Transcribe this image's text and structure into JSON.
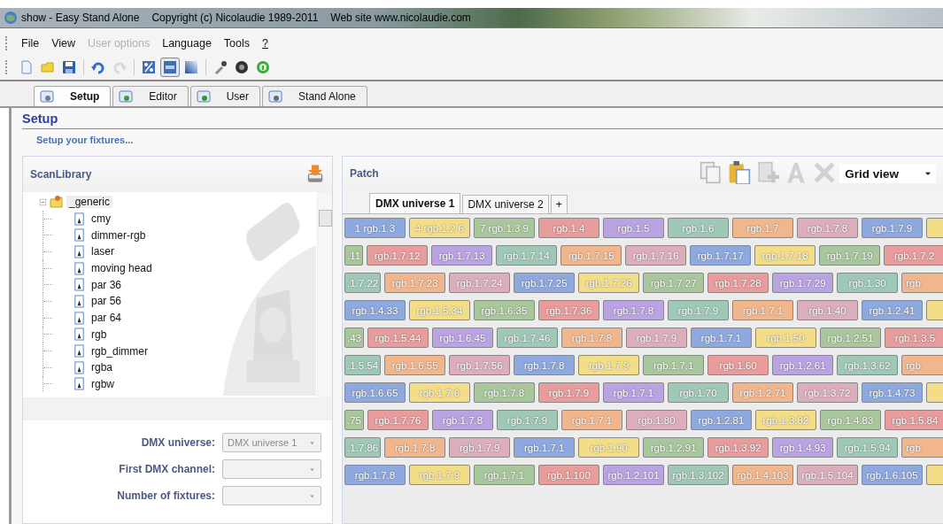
{
  "window": {
    "title": "show - Easy Stand Alone",
    "copyright": "Copyright (c) Nicolaudie 1989-2011",
    "website": "Web site www.nicolaudie.com"
  },
  "menu": [
    {
      "label": "File",
      "disabled": false,
      "underlined": false
    },
    {
      "label": "View",
      "disabled": false,
      "underlined": false
    },
    {
      "label": "User options",
      "disabled": true,
      "underlined": false
    },
    {
      "label": "Language",
      "disabled": false,
      "underlined": false
    },
    {
      "label": "Tools",
      "disabled": false,
      "underlined": false
    },
    {
      "label": "?",
      "disabled": false,
      "underlined": true
    }
  ],
  "toolbar": [
    {
      "kind": "new",
      "disabled": false,
      "pressed": false
    },
    {
      "kind": "open",
      "disabled": false,
      "pressed": false
    },
    {
      "kind": "save",
      "disabled": false,
      "pressed": false
    },
    {
      "kind": "sep"
    },
    {
      "kind": "undo",
      "disabled": false,
      "pressed": false
    },
    {
      "kind": "redo",
      "disabled": true,
      "pressed": false
    },
    {
      "kind": "sep"
    },
    {
      "kind": "percent",
      "disabled": false,
      "pressed": false
    },
    {
      "kind": "byte",
      "disabled": false,
      "pressed": true
    },
    {
      "kind": "gradient",
      "disabled": false,
      "pressed": false
    },
    {
      "kind": "sep"
    },
    {
      "kind": "picker",
      "disabled": false,
      "pressed": false
    },
    {
      "kind": "ball",
      "disabled": false,
      "pressed": false
    },
    {
      "kind": "help",
      "disabled": false,
      "pressed": false
    }
  ],
  "tabs": [
    {
      "label": "Setup",
      "kind": "setup",
      "selected": true
    },
    {
      "label": "Editor",
      "kind": "editor",
      "selected": false
    },
    {
      "label": "User",
      "kind": "user",
      "selected": false
    },
    {
      "label": "Stand Alone",
      "kind": "standalone",
      "selected": false
    }
  ],
  "page": {
    "title": "Setup",
    "subtitle": "Setup your fixtures..."
  },
  "library": {
    "title": "ScanLibrary",
    "tree": [
      {
        "label": "_generic",
        "expanded": true,
        "selected": true,
        "children": [
          {
            "label": "cmy"
          },
          {
            "label": "dimmer-rgb"
          },
          {
            "label": "laser"
          },
          {
            "label": "moving head"
          },
          {
            "label": "par 36"
          },
          {
            "label": "par 56"
          },
          {
            "label": "par 64"
          },
          {
            "label": "rgb"
          },
          {
            "label": "rgb_dimmer"
          },
          {
            "label": "rgba"
          },
          {
            "label": "rgbw"
          }
        ]
      }
    ]
  },
  "form": [
    {
      "label": "DMX universe:",
      "value": "DMX universe 1",
      "disabled": true
    },
    {
      "label": "First DMX channel:",
      "disabled": true
    },
    {
      "label": "Number of fixtures:",
      "disabled": true
    }
  ],
  "patch": {
    "title": "Patch",
    "tools": [
      {
        "kind": "copy",
        "disabled": true
      },
      {
        "kind": "paste",
        "disabled": false
      },
      {
        "kind": "add",
        "disabled": true
      },
      {
        "kind": "letter",
        "disabled": true
      },
      {
        "kind": "delete",
        "disabled": true
      }
    ],
    "view": "Grid view",
    "tabs": [
      {
        "label": "DMX universe 1",
        "selected": true
      },
      {
        "label": "DMX universe 2",
        "selected": false
      },
      {
        "label": "+",
        "selected": false
      }
    ],
    "grid": [
      [
        {
          "label": "1 rgb.1 3",
          "color": "#8ea9df",
          "kind": "full"
        },
        {
          "label": "4 rgb.1.2 6",
          "color": "#f3dd86",
          "kind": "full"
        },
        {
          "label": "7 rgb.1.3 9",
          "color": "#a9c79c",
          "kind": "full"
        },
        {
          "label": "rgb.1.4",
          "color": "#e89c9c",
          "kind": "full"
        },
        {
          "label": "rgb.1.5",
          "color": "#b9a3e3",
          "kind": "full"
        },
        {
          "label": "rgb.1.6",
          "color": "#9fc8b7",
          "kind": "full"
        },
        {
          "label": "rgb.1.7",
          "color": "#f2b68c",
          "kind": "full"
        },
        {
          "label": "rgb.1.7.8",
          "color": "#dcaebb",
          "kind": "full"
        },
        {
          "label": "rgb.1.7.9",
          "color": "#8ea9df",
          "kind": "full"
        },
        {
          "color": "#f3dd86",
          "kind": "full"
        }
      ],
      [
        {
          "label": ".11",
          "color": "#a9c79c",
          "kind": "partial"
        },
        {
          "label": "rgb.1.7.12",
          "color": "#e89c9c",
          "kind": "full"
        },
        {
          "label": "rgb.1.7.13",
          "color": "#b9a3e3",
          "kind": "full"
        },
        {
          "label": "rgb.1.7.14",
          "color": "#9fc8b7",
          "kind": "full"
        },
        {
          "label": "rgb.1.7.15",
          "color": "#f2b68c",
          "kind": "full"
        },
        {
          "label": "rgb.1.7.16",
          "color": "#dcaebb",
          "kind": "full"
        },
        {
          "label": "rgb.1.7.17",
          "color": "#8ea9df",
          "kind": "full"
        },
        {
          "label": "rgb.1.7.18",
          "color": "#f3dd86",
          "kind": "full"
        },
        {
          "label": "rgb.1.7.19",
          "color": "#a9c79c",
          "kind": "full"
        },
        {
          "label": "rgb.1.7.2",
          "color": "#e89c9c",
          "kind": "full"
        }
      ],
      [
        {
          "label": ".1.7.22",
          "color": "#9fc8b7",
          "kind": "partial"
        },
        {
          "label": "rgb.1.7.23",
          "color": "#f2b68c",
          "kind": "full"
        },
        {
          "label": "rgb.1.7.24",
          "color": "#dcaebb",
          "kind": "full"
        },
        {
          "label": "rgb.1.7.25",
          "color": "#8ea9df",
          "kind": "full"
        },
        {
          "label": "rgb.1.7.26",
          "color": "#f3dd86",
          "kind": "full"
        },
        {
          "label": "rgb.1.7.27",
          "color": "#a9c79c",
          "kind": "full"
        },
        {
          "label": "rgb.1.7.28",
          "color": "#e89c9c",
          "kind": "full"
        },
        {
          "label": "rgb.1.7.29",
          "color": "#b9a3e3",
          "kind": "full"
        },
        {
          "label": "rgb.1.30",
          "color": "#9fc8b7",
          "kind": "full"
        },
        {
          "label": "rgb",
          "color": "#f2b68c",
          "kind": "cut"
        }
      ],
      [
        {
          "label": "rgb.1.4.33",
          "color": "#8ea9df",
          "kind": "full"
        },
        {
          "label": "rgb.1.5.34",
          "color": "#f3dd86",
          "kind": "full"
        },
        {
          "label": "rgb.1.6.35",
          "color": "#a9c79c",
          "kind": "full"
        },
        {
          "label": "rgb.1.7.36",
          "color": "#e89c9c",
          "kind": "full"
        },
        {
          "label": "rgb.1.7.8",
          "color": "#b9a3e3",
          "kind": "full"
        },
        {
          "label": "rgb.1.7.9",
          "color": "#9fc8b7",
          "kind": "full"
        },
        {
          "label": "rgb.1.7.1",
          "color": "#f2b68c",
          "kind": "full"
        },
        {
          "label": "rgb.1.40",
          "color": "#dcaebb",
          "kind": "full"
        },
        {
          "label": "rgb.1.2.41",
          "color": "#8ea9df",
          "kind": "full"
        },
        {
          "color": "#f3dd86",
          "kind": "full"
        }
      ],
      [
        {
          "label": ".43",
          "color": "#a9c79c",
          "kind": "partial"
        },
        {
          "label": "rgb.1.5.44",
          "color": "#e89c9c",
          "kind": "full"
        },
        {
          "label": "rgb.1.6.45",
          "color": "#b9a3e3",
          "kind": "full"
        },
        {
          "label": "rgb.1.7.46",
          "color": "#9fc8b7",
          "kind": "full"
        },
        {
          "label": "rgb.1.7.8",
          "color": "#f2b68c",
          "kind": "full"
        },
        {
          "label": "rgb.1.7.9",
          "color": "#dcaebb",
          "kind": "full"
        },
        {
          "label": "rgb.1.7.1",
          "color": "#8ea9df",
          "kind": "full"
        },
        {
          "label": "rgb.1.50",
          "color": "#f3dd86",
          "kind": "full"
        },
        {
          "label": "rgb.1.2.51",
          "color": "#a9c79c",
          "kind": "full"
        },
        {
          "label": "rgb.1.3.5",
          "color": "#e89c9c",
          "kind": "full"
        }
      ],
      [
        {
          "label": ".1.5.54",
          "color": "#9fc8b7",
          "kind": "partial"
        },
        {
          "label": "rgb.1.6.55",
          "color": "#f2b68c",
          "kind": "full"
        },
        {
          "label": "rgb.1.7.56",
          "color": "#dcaebb",
          "kind": "full"
        },
        {
          "label": "rgb.1.7.8",
          "color": "#8ea9df",
          "kind": "full"
        },
        {
          "label": "rgb.1.7.9",
          "color": "#f3dd86",
          "kind": "full"
        },
        {
          "label": "rgb.1.7.1",
          "color": "#a9c79c",
          "kind": "full"
        },
        {
          "label": "rgb.1.60",
          "color": "#e89c9c",
          "kind": "full"
        },
        {
          "label": "rgb.1.2.61",
          "color": "#b9a3e3",
          "kind": "full"
        },
        {
          "label": "rgb.1.3.62",
          "color": "#9fc8b7",
          "kind": "full"
        },
        {
          "label": "rgb",
          "color": "#f2b68c",
          "kind": "cut"
        }
      ],
      [
        {
          "label": "rgb.1.6.65",
          "color": "#8ea9df",
          "kind": "full"
        },
        {
          "label": "rgb.1.7.6",
          "color": "#f3dd86",
          "kind": "full"
        },
        {
          "label": "rgb.1.7.8",
          "color": "#a9c79c",
          "kind": "full"
        },
        {
          "label": "rgb.1.7.9",
          "color": "#e89c9c",
          "kind": "full"
        },
        {
          "label": "rgb.1.7.1",
          "color": "#b9a3e3",
          "kind": "full"
        },
        {
          "label": "rgb.1.70",
          "color": "#9fc8b7",
          "kind": "full"
        },
        {
          "label": "rgb.1.2.71",
          "color": "#f2b68c",
          "kind": "full"
        },
        {
          "label": "rgb.1.3.72",
          "color": "#dcaebb",
          "kind": "full"
        },
        {
          "label": "rgb.1.4.73",
          "color": "#8ea9df",
          "kind": "full"
        },
        {
          "color": "#f3dd86",
          "kind": "full"
        }
      ],
      [
        {
          "label": ".75",
          "color": "#a9c79c",
          "kind": "partial"
        },
        {
          "label": "rgb.1.7.76",
          "color": "#e89c9c",
          "kind": "full"
        },
        {
          "label": "rgb.1.7.8",
          "color": "#b9a3e3",
          "kind": "full"
        },
        {
          "label": "rgb.1.7.9",
          "color": "#9fc8b7",
          "kind": "full"
        },
        {
          "label": "rgb.1.7.1",
          "color": "#f2b68c",
          "kind": "full"
        },
        {
          "label": "rgb.1.80",
          "color": "#dcaebb",
          "kind": "full"
        },
        {
          "label": "rgb.1.2.81",
          "color": "#8ea9df",
          "kind": "full"
        },
        {
          "label": "rgb.1.3.82",
          "color": "#f3dd86",
          "kind": "full"
        },
        {
          "label": "rgb.1.4.83",
          "color": "#a9c79c",
          "kind": "full"
        },
        {
          "label": "rgb.1.5.84",
          "color": "#e89c9c",
          "kind": "full"
        }
      ],
      [
        {
          "label": ".1.7.86",
          "color": "#9fc8b7",
          "kind": "partial"
        },
        {
          "label": "rgb.1.7.8",
          "color": "#f2b68c",
          "kind": "full"
        },
        {
          "label": "rgb.1.7.9",
          "color": "#dcaebb",
          "kind": "full"
        },
        {
          "label": "rgb.1.7.1",
          "color": "#8ea9df",
          "kind": "full"
        },
        {
          "label": "rgb.1.90",
          "color": "#f3dd86",
          "kind": "full"
        },
        {
          "label": "rgb.1.2.91",
          "color": "#a9c79c",
          "kind": "full"
        },
        {
          "label": "rgb.1.3.92",
          "color": "#e89c9c",
          "kind": "full"
        },
        {
          "label": "rgb.1.4.93",
          "color": "#b9a3e3",
          "kind": "full"
        },
        {
          "label": "rgb.1.5.94",
          "color": "#9fc8b7",
          "kind": "full"
        },
        {
          "label": "rgb",
          "color": "#f2b68c",
          "kind": "cut"
        }
      ],
      [
        {
          "label": "rgb.1.7.8",
          "color": "#8ea9df",
          "kind": "full"
        },
        {
          "label": "rgb.1.7.9",
          "color": "#f3dd86",
          "kind": "full"
        },
        {
          "label": "rgb.1.7.1",
          "color": "#a9c79c",
          "kind": "full"
        },
        {
          "label": "rgb.1.100",
          "color": "#e89c9c",
          "kind": "full"
        },
        {
          "label": "rgb.1.2.101",
          "color": "#b9a3e3",
          "kind": "full"
        },
        {
          "label": "rgb.1.3.102",
          "color": "#9fc8b7",
          "kind": "full"
        },
        {
          "label": "rgb.1.4.103",
          "color": "#f2b68c",
          "kind": "full"
        },
        {
          "label": "rgb.1.5.104",
          "color": "#dcaebb",
          "kind": "full"
        },
        {
          "label": "rgb.1.6.105",
          "color": "#8ea9df",
          "kind": "full"
        },
        {
          "color": "#f3dd86",
          "kind": "full"
        }
      ]
    ]
  }
}
